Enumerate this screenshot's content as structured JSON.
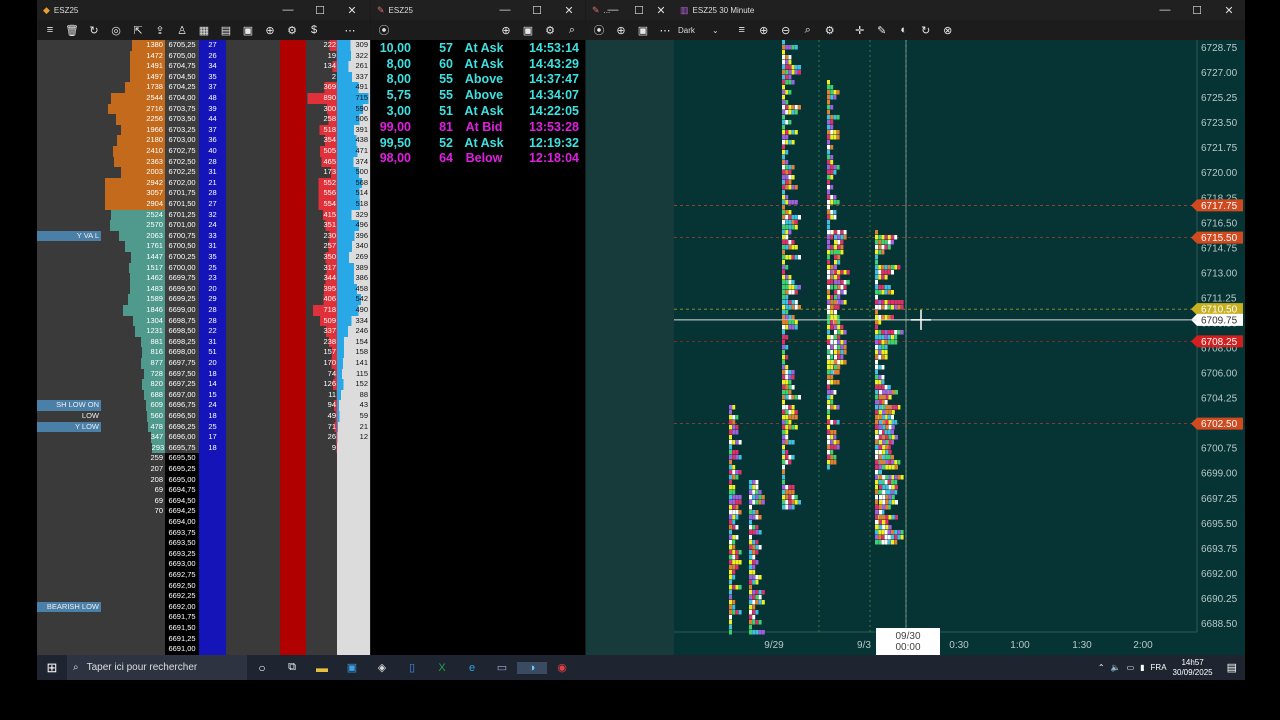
{
  "dom_window": {
    "title": "ESZ25",
    "rows": [
      {
        "label": "",
        "vol": "1380",
        "price": "6705,25",
        "bid": "27",
        "delta": "222",
        "tot": "309",
        "vc": "#c46a1c"
      },
      {
        "label": "",
        "vol": "1472",
        "price": "6705,00",
        "bid": "26",
        "delta": "19",
        "tot": "322",
        "vc": "#c46a1c"
      },
      {
        "label": "",
        "vol": "1491",
        "price": "6704,75",
        "bid": "34",
        "delta": "134",
        "tot": "261",
        "vc": "#c46a1c"
      },
      {
        "label": "",
        "vol": "1497",
        "price": "6704,50",
        "bid": "35",
        "delta": "2",
        "tot": "337",
        "vc": "#c46a1c"
      },
      {
        "label": "",
        "vol": "1738",
        "price": "6704,25",
        "bid": "37",
        "delta": "369",
        "tot": "491",
        "vc": "#c46a1c"
      },
      {
        "label": "",
        "vol": "2544",
        "price": "6704,00",
        "bid": "48",
        "delta": "890",
        "tot": "715",
        "vc": "#c46a1c"
      },
      {
        "label": "",
        "vol": "2716",
        "price": "6703,75",
        "bid": "39",
        "delta": "300",
        "tot": "590",
        "vc": "#c46a1c"
      },
      {
        "label": "",
        "vol": "2256",
        "price": "6703,50",
        "bid": "44",
        "delta": "258",
        "tot": "506",
        "vc": "#c46a1c"
      },
      {
        "label": "",
        "vol": "1966",
        "price": "6703,25",
        "bid": "37",
        "delta": "518",
        "tot": "391",
        "vc": "#c46a1c"
      },
      {
        "label": "",
        "vol": "2180",
        "price": "6703,00",
        "bid": "36",
        "delta": "354",
        "tot": "438",
        "vc": "#c46a1c"
      },
      {
        "label": "",
        "vol": "2410",
        "price": "6702,75",
        "bid": "40",
        "delta": "505",
        "tot": "471",
        "vc": "#c46a1c"
      },
      {
        "label": "",
        "vol": "2363",
        "price": "6702,50",
        "bid": "28",
        "delta": "465",
        "tot": "374",
        "vc": "#c46a1c"
      },
      {
        "label": "",
        "vol": "2003",
        "price": "6702,25",
        "bid": "31",
        "delta": "173",
        "tot": "500",
        "vc": "#c46a1c"
      },
      {
        "label": "",
        "vol": "2942",
        "price": "6702,00",
        "bid": "21",
        "delta": "552",
        "tot": "568",
        "vc": "#c46a1c"
      },
      {
        "label": "",
        "vol": "3057",
        "price": "6701,75",
        "bid": "28",
        "delta": "556",
        "tot": "514",
        "vc": "#c46a1c"
      },
      {
        "label": "",
        "vol": "2904",
        "price": "6701,50",
        "bid": "27",
        "delta": "554",
        "tot": "518",
        "vc": "#c46a1c"
      },
      {
        "label": "",
        "vol": "2524",
        "price": "6701,25",
        "bid": "32",
        "delta": "415",
        "tot": "329",
        "vc": "#4f9a8c"
      },
      {
        "label": "",
        "vol": "2570",
        "price": "6701,00",
        "bid": "24",
        "delta": "351",
        "tot": "496",
        "vc": "#4f9a8c"
      },
      {
        "label": "Y VA L",
        "vol": "2063",
        "price": "6700,75",
        "bid": "33",
        "delta": "230",
        "tot": "396",
        "vc": "#4f9a8c"
      },
      {
        "label": "",
        "vol": "1761",
        "price": "6700,50",
        "bid": "31",
        "delta": "257",
        "tot": "340",
        "vc": "#4f9a8c"
      },
      {
        "label": "",
        "vol": "1447",
        "price": "6700,25",
        "bid": "35",
        "delta": "350",
        "tot": "269",
        "vc": "#4f9a8c"
      },
      {
        "label": "",
        "vol": "1517",
        "price": "6700,00",
        "bid": "25",
        "delta": "317",
        "tot": "389",
        "vc": "#4f9a8c"
      },
      {
        "label": "",
        "vol": "1462",
        "price": "6699,75",
        "bid": "23",
        "delta": "344",
        "tot": "386",
        "vc": "#4f9a8c"
      },
      {
        "label": "",
        "vol": "1483",
        "price": "6699,50",
        "bid": "20",
        "delta": "395",
        "tot": "458",
        "vc": "#4f9a8c"
      },
      {
        "label": "",
        "vol": "1589",
        "price": "6699,25",
        "bid": "29",
        "delta": "406",
        "tot": "542",
        "vc": "#4f9a8c"
      },
      {
        "label": "",
        "vol": "1846",
        "price": "6699,00",
        "bid": "28",
        "delta": "718",
        "tot": "490",
        "vc": "#4f9a8c"
      },
      {
        "label": "",
        "vol": "1304",
        "price": "6698,75",
        "bid": "28",
        "delta": "509",
        "tot": "334",
        "vc": "#4f9a8c"
      },
      {
        "label": "",
        "vol": "1231",
        "price": "6698,50",
        "bid": "22",
        "delta": "337",
        "tot": "246",
        "vc": "#4f9a8c"
      },
      {
        "label": "",
        "vol": "881",
        "price": "6698,25",
        "bid": "31",
        "delta": "238",
        "tot": "154",
        "vc": "#4f9a8c"
      },
      {
        "label": "",
        "vol": "816",
        "price": "6698,00",
        "bid": "51",
        "delta": "157",
        "tot": "158",
        "vc": "#4f9a8c"
      },
      {
        "label": "",
        "vol": "877",
        "price": "6697,75",
        "bid": "20",
        "delta": "170",
        "tot": "141",
        "vc": "#4f9a8c"
      },
      {
        "label": "",
        "vol": "728",
        "price": "6697,50",
        "bid": "18",
        "delta": "74",
        "tot": "115",
        "vc": "#4f9a8c"
      },
      {
        "label": "",
        "vol": "820",
        "price": "6697,25",
        "bid": "14",
        "delta": "126",
        "tot": "152",
        "vc": "#4f9a8c"
      },
      {
        "label": "",
        "vol": "688",
        "price": "6697,00",
        "bid": "15",
        "delta": "11",
        "tot": "88",
        "vc": "#4f9a8c"
      },
      {
        "label": "SH LOW ON LOW",
        "vol": "609",
        "price": "6696,75",
        "bid": "24",
        "delta": "94",
        "tot": "43",
        "vc": "#4f9a8c"
      },
      {
        "label": "",
        "vol": "560",
        "price": "6696,50",
        "bid": "18",
        "delta": "49",
        "tot": "59",
        "vc": "#4f9a8c"
      },
      {
        "label": "Y LOW",
        "vol": "478",
        "price": "6696,25",
        "bid": "25",
        "delta": "71",
        "tot": "21",
        "vc": "#4f9a8c"
      },
      {
        "label": "",
        "vol": "347",
        "price": "6696,00",
        "bid": "17",
        "delta": "26",
        "tot": "12",
        "vc": "#4f9a8c"
      },
      {
        "label": "",
        "vol": "293",
        "price": "6695,75",
        "bid": "18",
        "delta": "9",
        "tot": "",
        "vc": "#4f9a8c"
      },
      {
        "label": "",
        "vol": "259",
        "price": "6695,50",
        "bid": "",
        "delta": "",
        "tot": "",
        "vc": ""
      },
      {
        "label": "",
        "vol": "207",
        "price": "6695,25",
        "bid": "",
        "delta": "",
        "tot": "",
        "vc": ""
      },
      {
        "label": "",
        "vol": "208",
        "price": "6695,00",
        "bid": "",
        "delta": "",
        "tot": "",
        "vc": ""
      },
      {
        "label": "",
        "vol": "69",
        "price": "6694,75",
        "bid": "",
        "delta": "",
        "tot": "",
        "vc": ""
      },
      {
        "label": "",
        "vol": "69",
        "price": "6694,50",
        "bid": "",
        "delta": "",
        "tot": "",
        "vc": ""
      },
      {
        "label": "",
        "vol": "70",
        "price": "6694,25",
        "bid": "",
        "delta": "",
        "tot": "",
        "vc": ""
      },
      {
        "label": "",
        "vol": "",
        "price": "6694,00",
        "bid": "",
        "delta": "",
        "tot": "",
        "vc": ""
      },
      {
        "label": "",
        "vol": "",
        "price": "6693,75",
        "bid": "",
        "delta": "",
        "tot": "",
        "vc": ""
      },
      {
        "label": "",
        "vol": "",
        "price": "6693,50",
        "bid": "",
        "delta": "",
        "tot": "",
        "vc": ""
      },
      {
        "label": "",
        "vol": "",
        "price": "6693,25",
        "bid": "",
        "delta": "",
        "tot": "",
        "vc": ""
      },
      {
        "label": "",
        "vol": "",
        "price": "6693,00",
        "bid": "",
        "delta": "",
        "tot": "",
        "vc": ""
      },
      {
        "label": "",
        "vol": "",
        "price": "6692,75",
        "bid": "",
        "delta": "",
        "tot": "",
        "vc": ""
      },
      {
        "label": "",
        "vol": "",
        "price": "6692,50",
        "bid": "",
        "delta": "",
        "tot": "",
        "vc": ""
      },
      {
        "label": "",
        "vol": "",
        "price": "6692,25",
        "bid": "",
        "delta": "",
        "tot": "",
        "vc": ""
      },
      {
        "label": "BEARISH LOW",
        "vol": "",
        "price": "6692,00",
        "bid": "",
        "delta": "",
        "tot": "",
        "vc": ""
      },
      {
        "label": "",
        "vol": "",
        "price": "6691,75",
        "bid": "",
        "delta": "",
        "tot": "",
        "vc": ""
      },
      {
        "label": "",
        "vol": "",
        "price": "6691,50",
        "bid": "",
        "delta": "",
        "tot": "",
        "vc": ""
      },
      {
        "label": "",
        "vol": "",
        "price": "6691,25",
        "bid": "",
        "delta": "",
        "tot": "",
        "vc": ""
      },
      {
        "label": "",
        "vol": "",
        "price": "6691,00",
        "bid": "",
        "delta": "",
        "tot": "",
        "vc": ""
      }
    ]
  },
  "ts_window": {
    "title": "ESZ25",
    "rows": [
      {
        "price": "10,00",
        "size": "57",
        "type": "At Ask",
        "time": "14:53:14",
        "color": "#3fe0e0"
      },
      {
        "price": "8,00",
        "size": "60",
        "type": "At Ask",
        "time": "14:43:29",
        "color": "#3fe0e0"
      },
      {
        "price": "8,00",
        "size": "55",
        "type": "Above",
        "time": "14:37:47",
        "color": "#3fe0e0"
      },
      {
        "price": "5,75",
        "size": "55",
        "type": "Above",
        "time": "14:34:07",
        "color": "#3fe0e0"
      },
      {
        "price": "3,00",
        "size": "51",
        "type": "At Ask",
        "time": "14:22:05",
        "color": "#3fe0e0"
      },
      {
        "price": "99,00",
        "size": "81",
        "type": "At Bid",
        "time": "13:53:28",
        "color": "#e020e0"
      },
      {
        "price": "99,50",
        "size": "52",
        "type": "At Ask",
        "time": "12:19:32",
        "color": "#3fe0e0"
      },
      {
        "price": "98,00",
        "size": "64",
        "type": "Below",
        "time": "12:18:04",
        "color": "#e020e0"
      }
    ]
  },
  "mini_window": {
    "title": "..."
  },
  "chart_window": {
    "title": "ESZ25 30 Minute",
    "theme_select": "Dark",
    "price_axis": [
      "6728.75",
      "6727.00",
      "6725.25",
      "6723.50",
      "6721.75",
      "6720.00",
      "6718.25",
      "6716.50",
      "6714.75",
      "6713.00",
      "6711.25",
      "6709.50",
      "6708.00",
      "6706.00",
      "6704.25",
      "6702.50",
      "6700.75",
      "6699.00",
      "6697.25",
      "6695.50",
      "6693.75",
      "6692.00",
      "6690.25",
      "6688.50"
    ],
    "price_tags": [
      {
        "value": "6717.75",
        "color": "#d04a20"
      },
      {
        "value": "6715.50",
        "color": "#d04a20"
      },
      {
        "value": "6710.50",
        "color": "#c8b020"
      },
      {
        "value": "6709.75",
        "color": "#ffffff"
      },
      {
        "value": "6708.25",
        "color": "#d02020"
      },
      {
        "value": "6702.50",
        "color": "#d04a20"
      }
    ],
    "time_axis": [
      "9/29",
      "9/3",
      "0:30",
      "1:00",
      "1:30",
      "2:00"
    ],
    "crosshair_time": [
      "09/30",
      "00:00"
    ]
  },
  "taskbar": {
    "search_placeholder": "Taper ici pour rechercher",
    "lang": "FRA",
    "time": "14h57",
    "date": "30/09/2025"
  }
}
